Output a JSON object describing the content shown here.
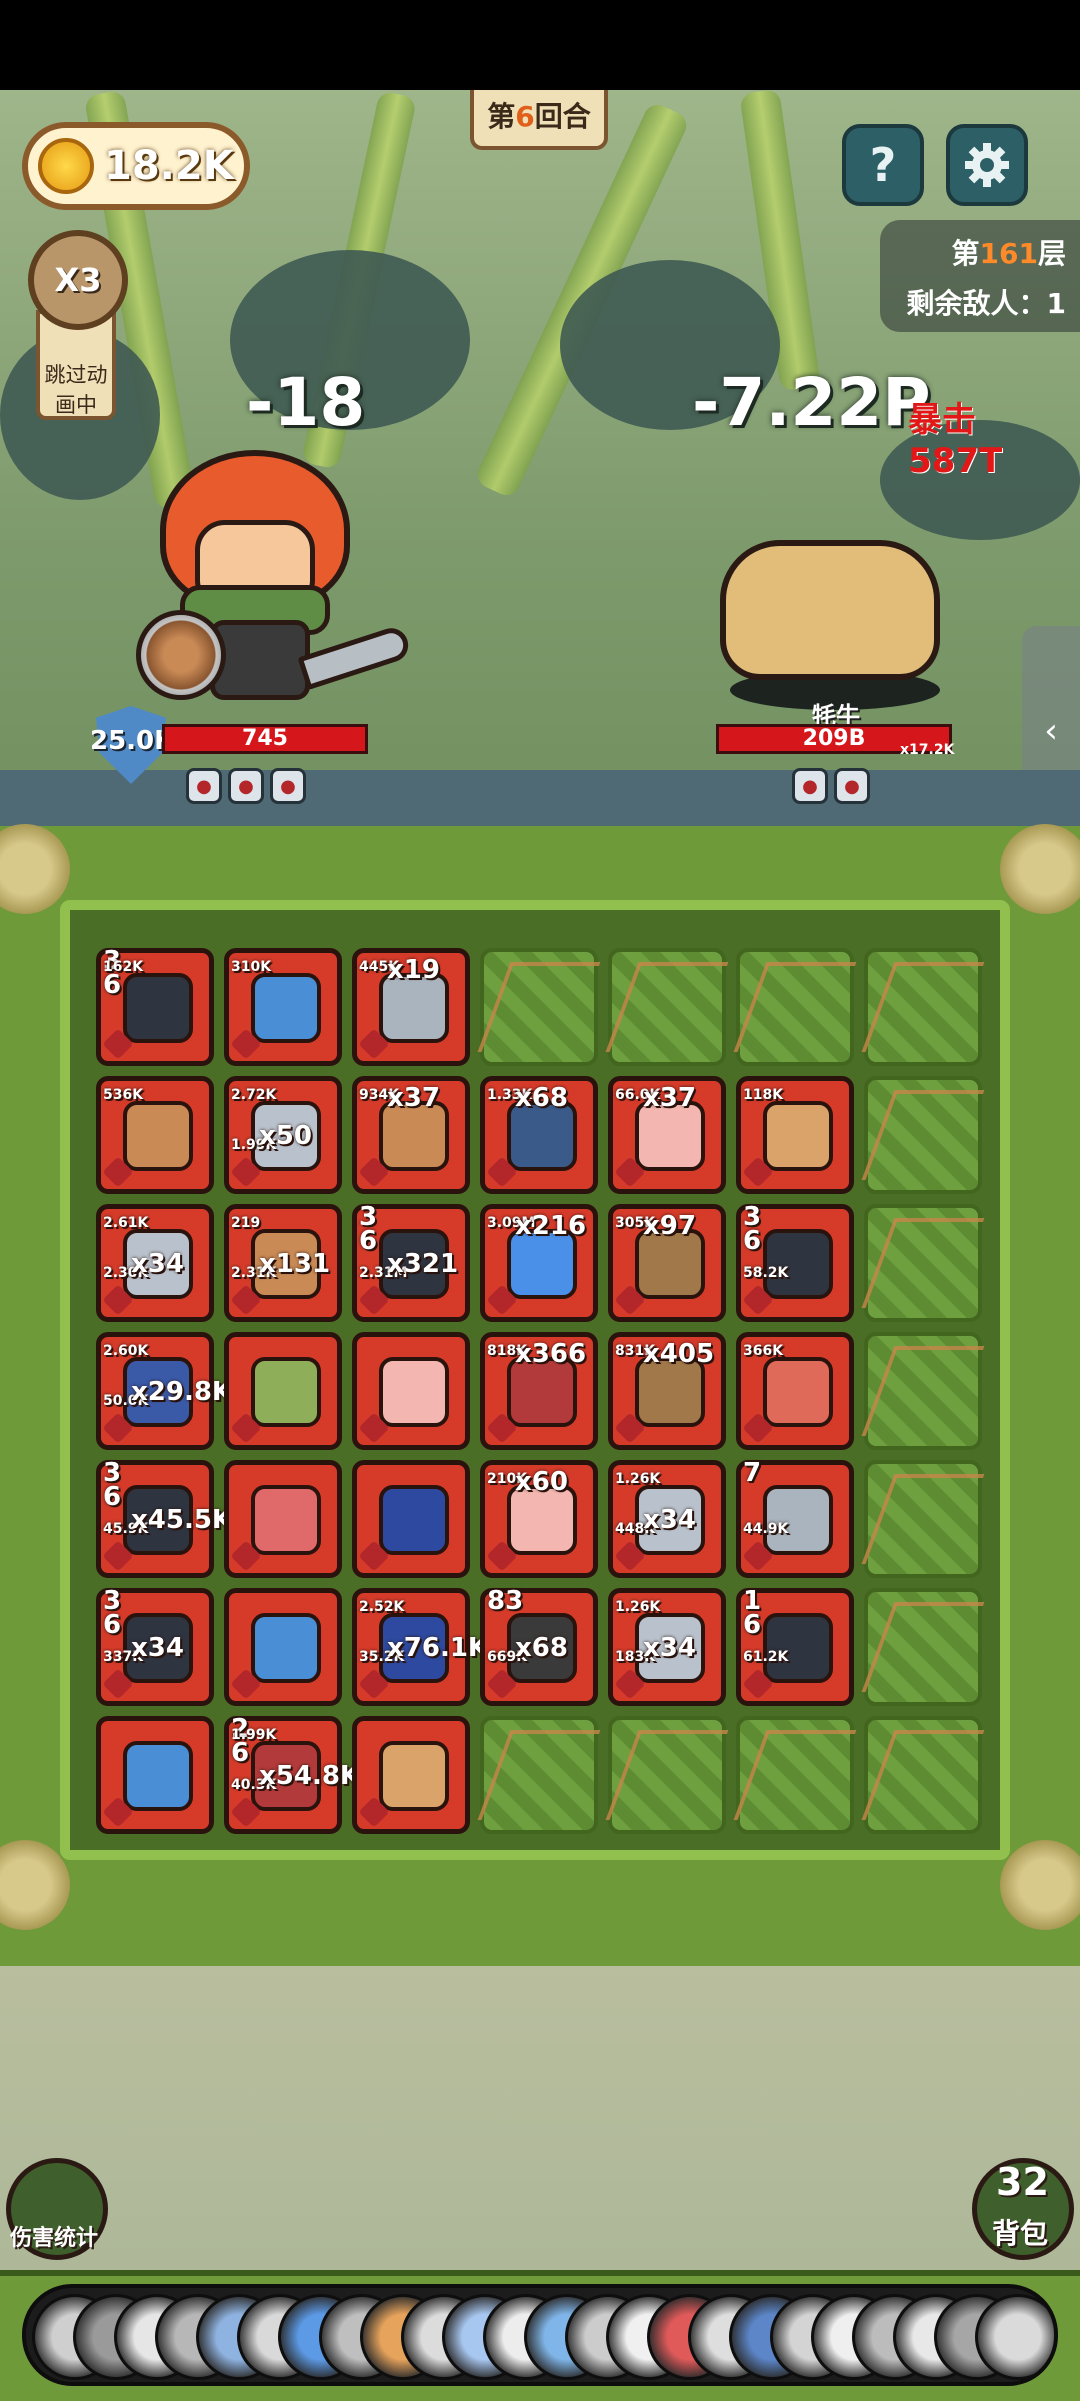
{
  "hud": {
    "coins": "18.2K",
    "round_prefix": "第",
    "round_num": "6",
    "round_suffix": "回合",
    "help_icon": "?",
    "floor_prefix": "第",
    "floor_num": "161",
    "floor_suffix": "层",
    "enemies_left": "剩余敌人：1",
    "speed": "X3",
    "skip_anim": "跳过动画中"
  },
  "battle": {
    "hero_damage": "-18",
    "enemy_damage": "-7.22P",
    "crit_label": "暴击 587T",
    "hero_shield": "25.0K",
    "hero_hp": "745",
    "hero_hp_fraction": 1.0,
    "enemy_name": "牦牛",
    "enemy_hp": "209B",
    "enemy_hp_mult": "x17.2K",
    "enemy_hp_fraction": 1.0,
    "hero_statuses": [
      "ring-icon",
      "beetle-icon",
      "boots-icon"
    ],
    "enemy_statuses": [
      "target-icon",
      "no-attack-icon"
    ]
  },
  "board": {
    "cells": [
      {
        "r": 0,
        "c": 0,
        "type": "item",
        "art": "ninja",
        "color": "#2e3440",
        "lvl": "3\n6",
        "small": "162K"
      },
      {
        "r": 0,
        "c": 1,
        "type": "item",
        "art": "mage",
        "color": "#4a8ed6",
        "small": "310K"
      },
      {
        "r": 0,
        "c": 2,
        "type": "item",
        "art": "fence",
        "color": "#a9b4be",
        "small": "445K",
        "big": "x19"
      },
      {
        "r": 0,
        "c": 3,
        "type": "empty"
      },
      {
        "r": 0,
        "c": 4,
        "type": "empty"
      },
      {
        "r": 0,
        "c": 5,
        "type": "empty"
      },
      {
        "r": 0,
        "c": 6,
        "type": "empty"
      },
      {
        "r": 1,
        "c": 0,
        "type": "item",
        "art": "staff",
        "color": "#c98a56",
        "small": "536K"
      },
      {
        "r": 1,
        "c": 1,
        "type": "item",
        "art": "shield",
        "color": "#b9c2cc",
        "small": "2.72K",
        "small2": "1.99K",
        "big": "x50"
      },
      {
        "r": 1,
        "c": 2,
        "type": "item",
        "art": "staff",
        "color": "#c98a56",
        "small": "934K",
        "big": "x37"
      },
      {
        "r": 1,
        "c": 3,
        "type": "item",
        "art": "hammer",
        "color": "#3a5a8a",
        "small": "1.33K",
        "big": "x68"
      },
      {
        "r": 1,
        "c": 4,
        "type": "item",
        "art": "sword",
        "color": "#f3b6b0",
        "small": "66.0K",
        "big": "x37"
      },
      {
        "r": 1,
        "c": 5,
        "type": "item",
        "art": "nest",
        "color": "#d9a36a",
        "small": "118K"
      },
      {
        "r": 1,
        "c": 6,
        "type": "empty"
      },
      {
        "r": 2,
        "c": 0,
        "type": "item",
        "art": "shield",
        "color": "#b9c2cc",
        "small": "2.61K",
        "small2": "2.30K",
        "big": "x34"
      },
      {
        "r": 2,
        "c": 1,
        "type": "item",
        "art": "staff",
        "color": "#c98a56",
        "small": "219",
        "small2": "2.31K",
        "big": "x131"
      },
      {
        "r": 2,
        "c": 2,
        "type": "item",
        "art": "ninja",
        "color": "#2e3440",
        "lvl": "3\n6",
        "small2": "2.31M",
        "big": "x321"
      },
      {
        "r": 2,
        "c": 3,
        "type": "item",
        "art": "slime",
        "color": "#4a90e8",
        "small": "3.09M",
        "big": "x216"
      },
      {
        "r": 2,
        "c": 4,
        "type": "item",
        "art": "bag",
        "color": "#a0784a",
        "small": "305K",
        "big": "x97"
      },
      {
        "r": 2,
        "c": 5,
        "type": "item",
        "art": "ninja",
        "color": "#2e3440",
        "lvl": "3\n6",
        "small2": "58.2K"
      },
      {
        "r": 2,
        "c": 6,
        "type": "empty"
      },
      {
        "r": 3,
        "c": 0,
        "type": "item",
        "art": "club",
        "color": "#3a5aa8",
        "small": "2.60K",
        "small2": "50.0K",
        "big": "x29.8K"
      },
      {
        "r": 3,
        "c": 1,
        "type": "item",
        "art": "nest",
        "color": "#8fae5a"
      },
      {
        "r": 3,
        "c": 2,
        "type": "item",
        "art": "sword",
        "color": "#f3b6b0"
      },
      {
        "r": 3,
        "c": 3,
        "type": "item",
        "art": "ninja",
        "color": "#b33a3a",
        "small": "818K",
        "big": "x366"
      },
      {
        "r": 3,
        "c": 4,
        "type": "item",
        "art": "bag",
        "color": "#a0784a",
        "small": "831K",
        "big": "x405"
      },
      {
        "r": 3,
        "c": 5,
        "type": "item",
        "art": "flag",
        "color": "#e06a5a",
        "small": "366K"
      },
      {
        "r": 3,
        "c": 6,
        "type": "empty"
      },
      {
        "r": 4,
        "c": 0,
        "type": "item",
        "art": "ninja",
        "color": "#2e3440",
        "lvl": "3\n6",
        "small2": "45.9K",
        "big": "x45.5K"
      },
      {
        "r": 4,
        "c": 1,
        "type": "item",
        "art": "shield",
        "color": "#e06a6a"
      },
      {
        "r": 4,
        "c": 2,
        "type": "item",
        "art": "scroll",
        "color": "#2d4aa0"
      },
      {
        "r": 4,
        "c": 3,
        "type": "item",
        "art": "sword",
        "color": "#f3b6b0",
        "small": "210K",
        "big": "x60"
      },
      {
        "r": 4,
        "c": 4,
        "type": "item",
        "art": "shield",
        "color": "#b9c2cc",
        "small": "1.26K",
        "small2": "448K",
        "big": "x34"
      },
      {
        "r": 4,
        "c": 5,
        "type": "item",
        "art": "cannon",
        "color": "#a9b4be",
        "lvl": "7",
        "small2": "44.9K"
      },
      {
        "r": 4,
        "c": 6,
        "type": "empty"
      },
      {
        "r": 5,
        "c": 0,
        "type": "item",
        "art": "ninja",
        "color": "#2e3440",
        "lvl": "3\n6",
        "small2": "337K",
        "big": "x34"
      },
      {
        "r": 5,
        "c": 1,
        "type": "item",
        "art": "mage",
        "color": "#4a8ed6"
      },
      {
        "r": 5,
        "c": 2,
        "type": "item",
        "art": "scroll",
        "color": "#2d4aa0",
        "small": "2.52K",
        "small2": "35.2K",
        "big": "x76.1K"
      },
      {
        "r": 5,
        "c": 3,
        "type": "item",
        "art": "hammer",
        "color": "#3a3a3a",
        "lvl": "83",
        "small2": "669K",
        "big": "x68"
      },
      {
        "r": 5,
        "c": 4,
        "type": "item",
        "art": "shield",
        "color": "#b9c2cc",
        "small": "1.26K",
        "small2": "183K",
        "big": "x34"
      },
      {
        "r": 5,
        "c": 5,
        "type": "item",
        "art": "ninja",
        "color": "#2e3440",
        "lvl": "1\n6",
        "small2": "61.2K"
      },
      {
        "r": 5,
        "c": 6,
        "type": "empty"
      },
      {
        "r": 6,
        "c": 0,
        "type": "item",
        "art": "mage",
        "color": "#4a8ed6"
      },
      {
        "r": 6,
        "c": 1,
        "type": "item",
        "art": "ninja",
        "color": "#b33a3a",
        "lvl": "2\n6",
        "small": "1.99K",
        "small2": "40.3K",
        "big": "x54.8K"
      },
      {
        "r": 6,
        "c": 2,
        "type": "item",
        "art": "nest",
        "color": "#d9a36a"
      },
      {
        "r": 6,
        "c": 3,
        "type": "empty"
      },
      {
        "r": 6,
        "c": 4,
        "type": "empty"
      },
      {
        "r": 6,
        "c": 5,
        "type": "empty"
      },
      {
        "r": 6,
        "c": 6,
        "type": "empty"
      }
    ]
  },
  "bottom": {
    "damage_stats_label": "伤害统计",
    "bag_count": "32",
    "bag_label": "背包",
    "queue_colors": [
      "#cfcfcf",
      "#9a9a9a",
      "#e6e6e6",
      "#b7b7b7",
      "#8fb3e0",
      "#d9d9d9",
      "#5c9ae6",
      "#bfbfbf",
      "#e6a35c",
      "#dcdcdc",
      "#a8c7f0",
      "#ededed",
      "#7fb5e8",
      "#cccccc",
      "#f0f0f0",
      "#e05a5a",
      "#dedede",
      "#5c86c8",
      "#d4d4d4",
      "#efefef",
      "#bcbcbc",
      "#e8e8e8",
      "#a6a6a6",
      "#dadada"
    ]
  }
}
